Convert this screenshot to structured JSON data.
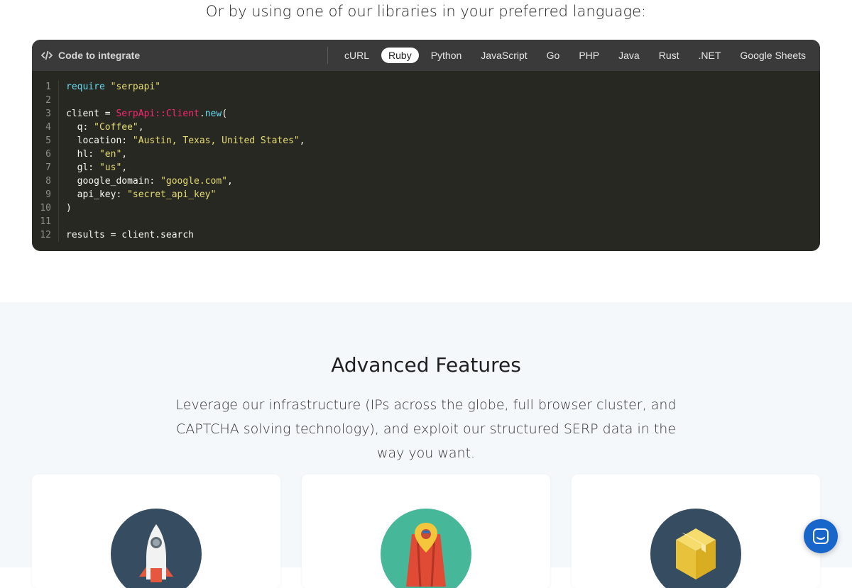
{
  "intro": {
    "text": "Or by using one of our libraries in your preferred language:"
  },
  "code_panel": {
    "title": "Code to integrate",
    "tabs": [
      {
        "label": "cURL"
      },
      {
        "label": "Ruby"
      },
      {
        "label": "Python"
      },
      {
        "label": "JavaScript"
      },
      {
        "label": "Go"
      },
      {
        "label": "PHP"
      },
      {
        "label": "Java"
      },
      {
        "label": "Rust"
      },
      {
        "label": ".NET"
      },
      {
        "label": "Google Sheets"
      }
    ],
    "active_tab": "Ruby",
    "line_numbers": [
      "1",
      "2",
      "3",
      "4",
      "5",
      "6",
      "7",
      "8",
      "9",
      "10",
      "11",
      "12"
    ],
    "code": {
      "l1_kw": "require",
      "l1_str": "\"serpapi\"",
      "l3_var": "client = ",
      "l3_cls1": "SerpApi",
      "l3_sep": "::",
      "l3_cls2": "Client",
      "l3_dot": ".",
      "l3_new": "new",
      "l3_paren": "(",
      "l4_key": "  q: ",
      "l4_val": "\"Coffee\"",
      "comma": ",",
      "l5_key": "  location: ",
      "l5_val": "\"Austin, Texas, United States\"",
      "l6_key": "  hl: ",
      "l6_val": "\"en\"",
      "l7_key": "  gl: ",
      "l7_val": "\"us\"",
      "l8_key": "  google_domain: ",
      "l8_val": "\"google.com\"",
      "l9_key": "  api_key: ",
      "l9_val": "\"secret_api_key\"",
      "l10": ")",
      "l12": "results = client.search"
    }
  },
  "features": {
    "title": "Advanced Features",
    "description": "Leverage our infrastructure (IPs across the globe, full browser cluster, and CAPTCHA solving technology), and exploit our structured SERP data in the way you want.",
    "cards": [
      {
        "icon": "rocket-icon"
      },
      {
        "icon": "map-pin-icon"
      },
      {
        "icon": "box-icon"
      }
    ]
  },
  "colors": {
    "code_bg": "#272822",
    "header_bg": "#3a3a3a",
    "chat": "#1866c9",
    "section_bg": "#f5f8fb"
  }
}
